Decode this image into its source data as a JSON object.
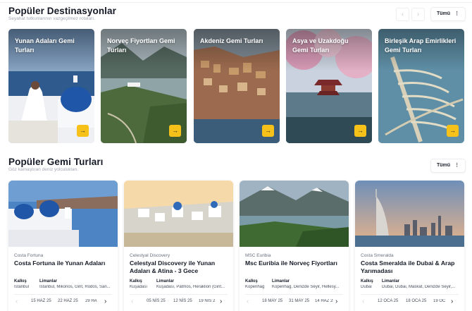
{
  "destinations_section": {
    "title": "Popüler Destinasyonlar",
    "subtitle": "Seyahat tutkunlarının vazgeçilmez rotaları.",
    "prev_icon": "chevron-left-icon",
    "next_icon": "chevron-right-icon",
    "all_label": "Tümü",
    "all_icon": "more-vertical-icon",
    "cards": [
      {
        "title": "Yunan Adaları Gemi Turları",
        "arrow": "→"
      },
      {
        "title": "Norveç Fiyortları Gemi Turları",
        "arrow": "→"
      },
      {
        "title": "Akdeniz Gemi Turları",
        "arrow": "→"
      },
      {
        "title": "Asya ve Uzakdoğu Gemi Turları",
        "arrow": "→"
      },
      {
        "title": "Birleşik Arap Emirlikleri Gemi Turları",
        "arrow": "→"
      }
    ]
  },
  "cruises_section": {
    "title": "Popüler Gemi Turları",
    "subtitle": "Göz kamaştıran deniz yolculukları.",
    "all_label": "Tümü",
    "all_icon": "more-vertical-icon",
    "departure_label": "Kalkış",
    "ports_label": "Limanlar",
    "cards": [
      {
        "ship": "Costa Fortuna",
        "title": "Costa Fortuna ile Yunan Adaları",
        "departure": "İstanbul",
        "ports": "İstanbul, Mikonos, Girit, Rodos, San...",
        "dates": [
          "15 HAZ 25",
          "22 HAZ 25",
          "29 HA"
        ]
      },
      {
        "ship": "Celestyal Discovery",
        "title": "Celestyal Discovery ile Yunan Adaları & Atina - 3 Gece",
        "departure": "Kuşadası",
        "ports": "Kuşadası, Patmos, Heraklion (Girit...",
        "dates": [
          "05 NİS 25",
          "12 NİS 25",
          "19 NİS 2"
        ]
      },
      {
        "ship": "MSC Euribia",
        "title": "Msc Euribia ile Norveç Fiyortları",
        "departure": "Kopenhag",
        "ports": "Kopenhag, Denizde Seyir, Hellesy...",
        "dates": [
          "18 MAY 25",
          "31 MAY 25",
          "14 HAZ 25"
        ]
      },
      {
        "ship": "Costa Smeralda",
        "title": "Costa Smeralda ile Dubai & Arap Yarımadası",
        "departure": "Dubai",
        "ports": "Dubai, Dubai, Maskat, Denizde Seyir,...",
        "dates": [
          "12 OCA 25",
          "18 OCA 25",
          "19 OC"
        ]
      }
    ]
  },
  "colors": {
    "accent": "#f6c21a",
    "title": "#151a26",
    "muted": "#a3a8b3"
  }
}
